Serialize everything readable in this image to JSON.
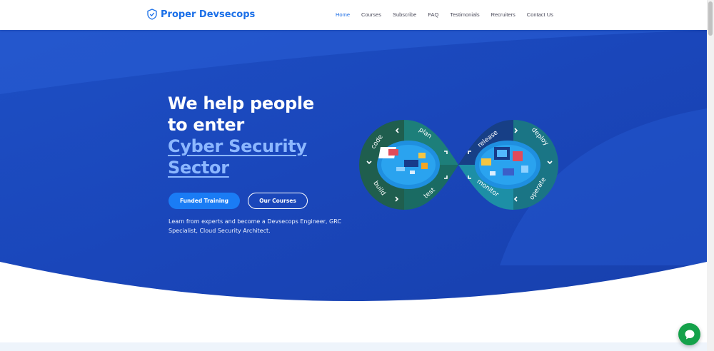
{
  "brand": {
    "name": "Proper Devsecops",
    "color": "#1a6fe8"
  },
  "nav": {
    "items": [
      {
        "label": "Home",
        "active": true
      },
      {
        "label": "Courses",
        "active": false
      },
      {
        "label": "Subscribe",
        "active": false
      },
      {
        "label": "FAQ",
        "active": false
      },
      {
        "label": "Testimonials",
        "active": false
      },
      {
        "label": "Recruiters",
        "active": false
      },
      {
        "label": "Contact Us",
        "active": false
      }
    ]
  },
  "hero": {
    "headline_line1": "We help people",
    "headline_line2": "to enter",
    "headline_highlight": "Cyber Security Sector",
    "primary_button": "Funded Training",
    "secondary_button": "Our Courses",
    "description": "Learn from experts and become a Devsecops Engineer, GRC Specialist, Cloud Security Architect."
  },
  "devops_loop": {
    "left_labels": [
      "code",
      "plan",
      "build",
      "test"
    ],
    "right_labels": [
      "release",
      "deploy",
      "monitor",
      "operate"
    ]
  },
  "colors": {
    "hero_bg": "#1a44b6",
    "button_primary": "#1a7cf5",
    "highlight_text": "#8cb7ff",
    "chat_button": "#14a14a"
  },
  "icons": {
    "logo": "shield-icon",
    "chat": "chat-bubble-icon"
  }
}
